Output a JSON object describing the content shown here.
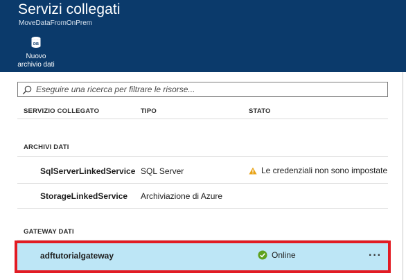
{
  "header": {
    "title": "Servizi collegati",
    "subtitle": "MoveDataFromOnPrem",
    "new_store_button": {
      "label": "Nuovo\narchivio dati",
      "icon_text": "DB"
    }
  },
  "search": {
    "placeholder": "Eseguire una ricerca per filtrare le risorse..."
  },
  "columns": {
    "service": "SERVIZIO COLLEGATO",
    "type": "TIPO",
    "status": "STATO"
  },
  "data_stores": {
    "label": "ARCHIVI DATI",
    "items": [
      {
        "name": "SqlServerLinkedService",
        "type": "SQL Server",
        "status": "Le credenziali non sono impostate",
        "status_icon": "warning-icon"
      },
      {
        "name": "StorageLinkedService",
        "type": "Archiviazione di Azure",
        "status": ""
      }
    ]
  },
  "gateways": {
    "label": "GATEWAY DATI",
    "items": [
      {
        "name": "adftutorialgateway",
        "status": "Online",
        "status_icon": "check-circle-icon",
        "more": "···",
        "selected": true
      }
    ]
  },
  "colors": {
    "header_bg": "#0b3a6b",
    "selected_bg": "#bde6f6",
    "highlight_border": "#e21b23",
    "warning": "#e8a317",
    "online": "#5ea11e"
  }
}
